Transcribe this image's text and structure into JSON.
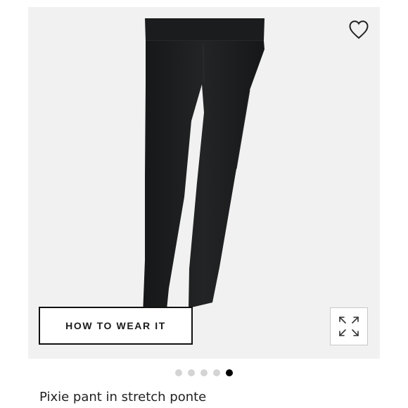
{
  "product": {
    "title": "Pixie pant in stretch ponte"
  },
  "gallery": {
    "how_to_wear_label": "HOW TO WEAR IT",
    "image_count": 5,
    "active_index": 4,
    "wishlist_icon": "heart-outline-icon",
    "expand_icon": "expand-arrows-icon"
  },
  "colors": {
    "image_background": "#f1f1f1",
    "pants": "#1e1f20",
    "dot_active": "#000000",
    "dot_inactive": "#d4d4d4"
  }
}
